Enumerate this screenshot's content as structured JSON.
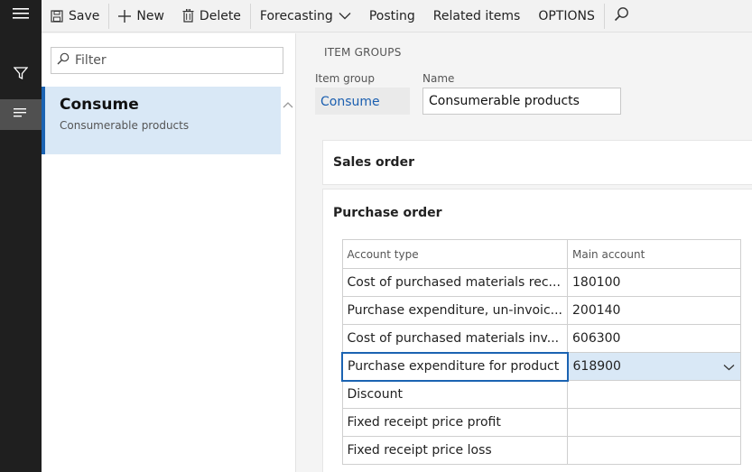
{
  "toolbar": {
    "save_label": "Save",
    "new_label": "New",
    "delete_label": "Delete",
    "forecasting_label": "Forecasting",
    "posting_label": "Posting",
    "related_label": "Related items",
    "options_label": "OPTIONS"
  },
  "rail": {
    "icons": [
      "hamburger-icon",
      "filter-icon",
      "list-icon"
    ]
  },
  "list": {
    "filter_placeholder": "Filter",
    "items": [
      {
        "title": "Consume",
        "subtitle": "Consumerable products"
      }
    ]
  },
  "detail": {
    "caption": "ITEM GROUPS",
    "item_group_label": "Item group",
    "item_group_value": "Consume",
    "name_label": "Name",
    "name_value": "Consumerable products",
    "sections": {
      "sales": "Sales order",
      "purchase": "Purchase order"
    },
    "grid": {
      "headers": [
        "Account type",
        "Main account"
      ],
      "rows": [
        {
          "account_type": "Cost of purchased materials rec...",
          "main_account": "180100"
        },
        {
          "account_type": "Purchase expenditure, un-invoic...",
          "main_account": "200140"
        },
        {
          "account_type": "Cost of purchased materials inv...",
          "main_account": "606300"
        },
        {
          "account_type": "Purchase expenditure for product",
          "main_account": "618900"
        },
        {
          "account_type": "Discount",
          "main_account": ""
        },
        {
          "account_type": "Fixed receipt price profit",
          "main_account": ""
        },
        {
          "account_type": "Fixed receipt price loss",
          "main_account": ""
        }
      ]
    }
  },
  "colors": {
    "rail": "#1f1f1f",
    "accent": "#1b63b2",
    "selection": "#d9e8f6",
    "link": "#1b5fb0"
  }
}
